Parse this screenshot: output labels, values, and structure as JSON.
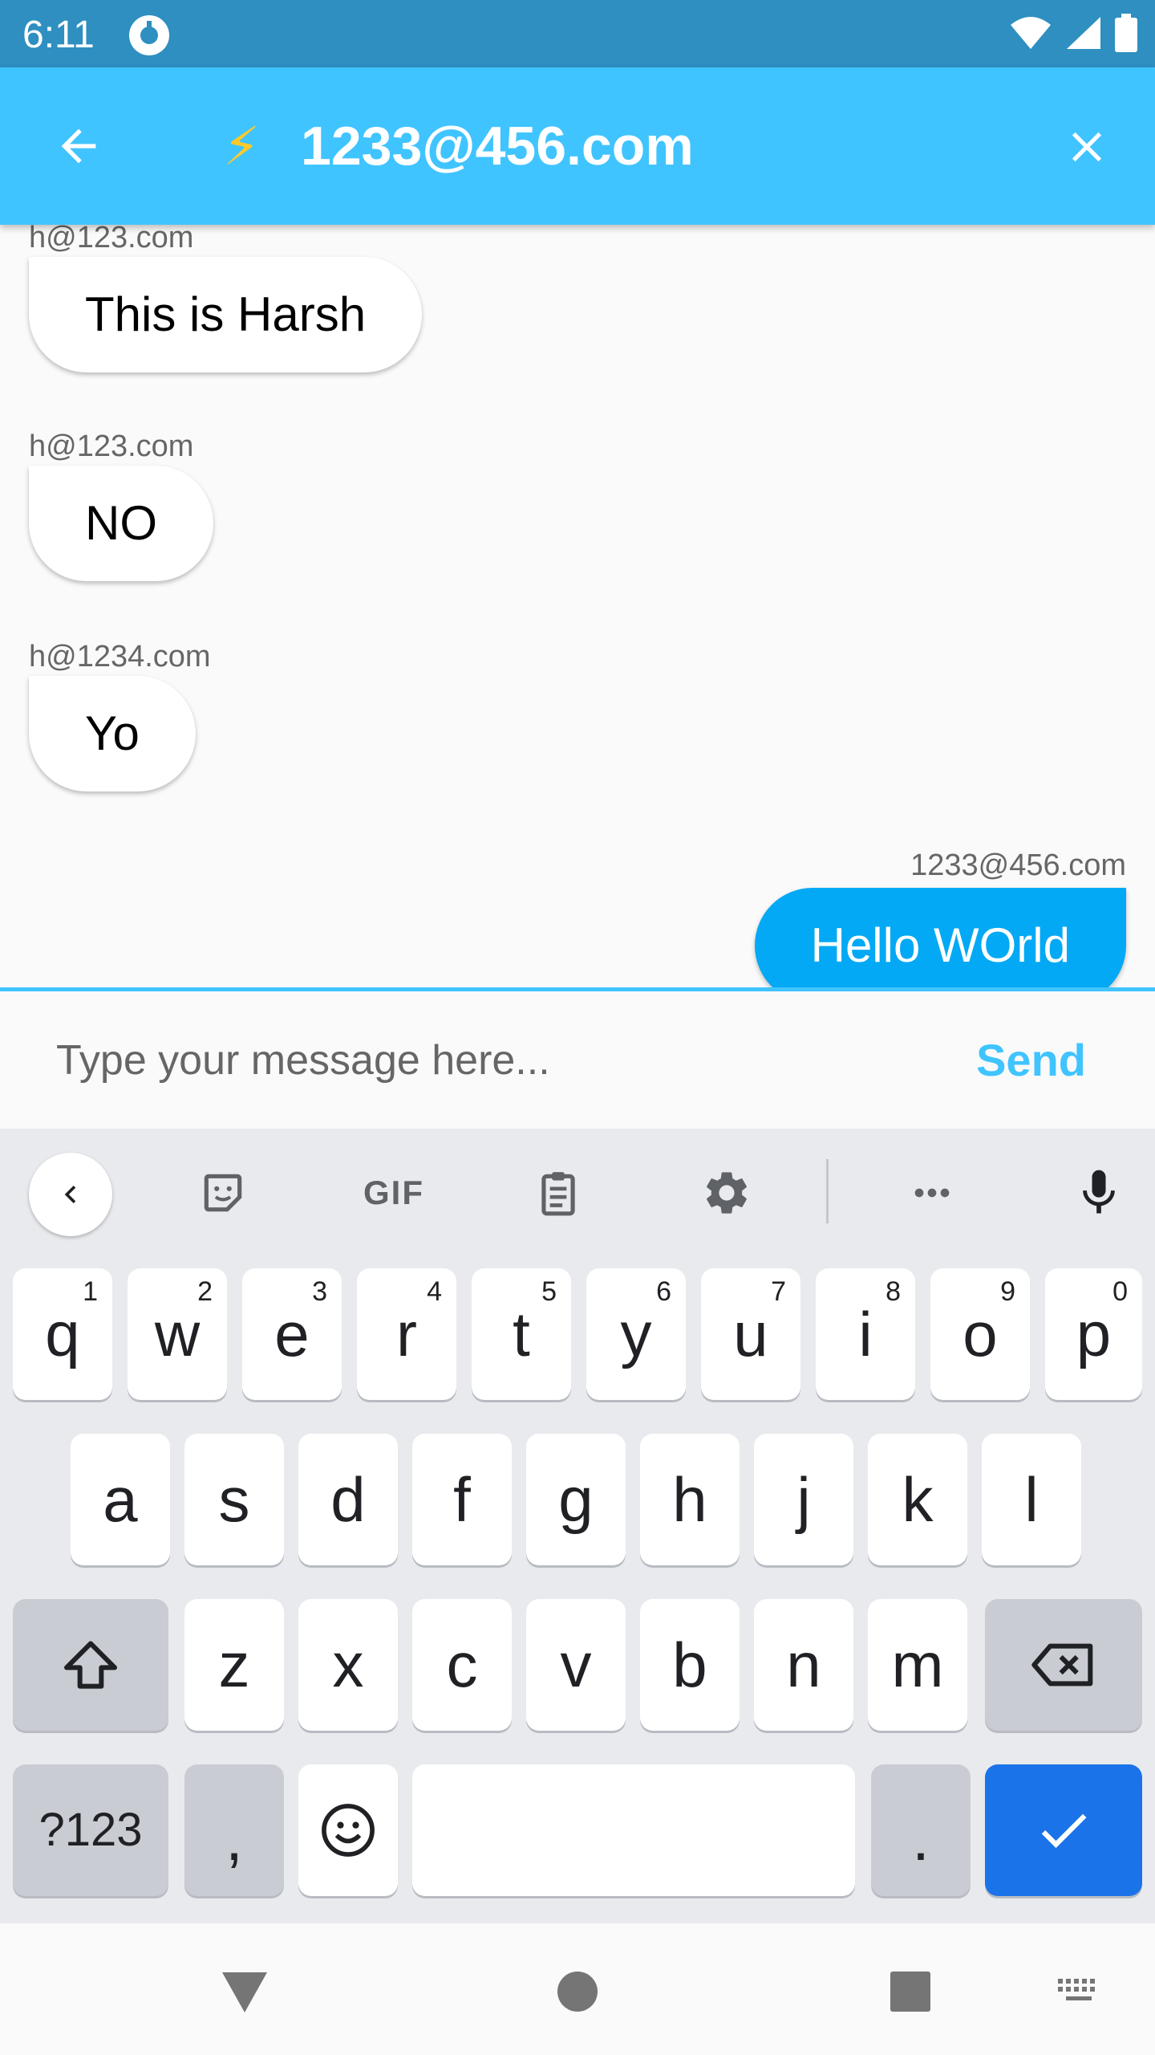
{
  "status_bar": {
    "time": "6:11"
  },
  "app_bar": {
    "title": "1233@456.com",
    "bolt": "⚡"
  },
  "messages": [
    {
      "sender": "h@123.com",
      "text": "This is Harsh",
      "direction": "incoming"
    },
    {
      "sender": "h@123.com",
      "text": "NO",
      "direction": "incoming"
    },
    {
      "sender": "h@1234.com",
      "text": "Yo",
      "direction": "incoming"
    },
    {
      "sender": "1233@456.com",
      "text": "Hello WOrld",
      "direction": "outgoing"
    }
  ],
  "composer": {
    "placeholder": "Type your message here...",
    "send_label": "Send"
  },
  "keyboard": {
    "toolbar": {
      "gif_label": "GIF"
    },
    "row1": [
      {
        "key": "q",
        "hint": "1"
      },
      {
        "key": "w",
        "hint": "2"
      },
      {
        "key": "e",
        "hint": "3"
      },
      {
        "key": "r",
        "hint": "4"
      },
      {
        "key": "t",
        "hint": "5"
      },
      {
        "key": "y",
        "hint": "6"
      },
      {
        "key": "u",
        "hint": "7"
      },
      {
        "key": "i",
        "hint": "8"
      },
      {
        "key": "o",
        "hint": "9"
      },
      {
        "key": "p",
        "hint": "0"
      }
    ],
    "row2": [
      "a",
      "s",
      "d",
      "f",
      "g",
      "h",
      "j",
      "k",
      "l"
    ],
    "row3": [
      "z",
      "x",
      "c",
      "v",
      "b",
      "n",
      "m"
    ],
    "symbols_label": "?123",
    "comma_label": ",",
    "period_label": "."
  },
  "colors": {
    "status_bar": "#2e8fc0",
    "app_bar": "#40c4ff",
    "outgoing_bubble": "#03a9f4",
    "enter_key": "#1a73e8"
  }
}
